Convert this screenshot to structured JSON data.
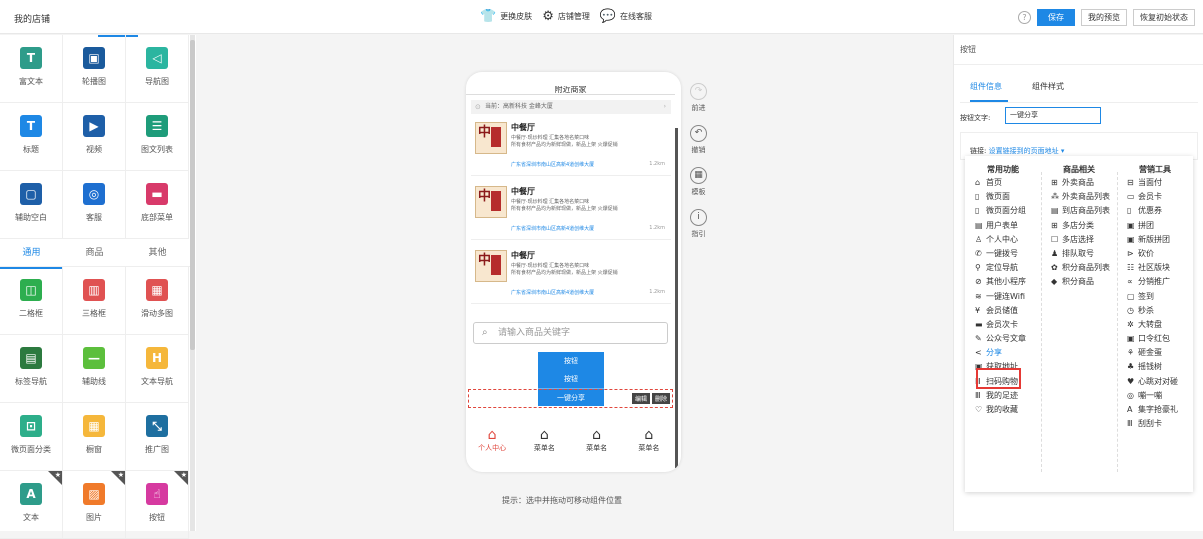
{
  "topbar": {
    "shop_title": "我的店铺",
    "actions": [
      {
        "label": "更换皮肤",
        "icon": "shirt-icon"
      },
      {
        "label": "店铺管理",
        "icon": "gear-icon"
      },
      {
        "label": "在线客服",
        "icon": "chat-icon"
      }
    ],
    "help": "?",
    "save_label": "保存",
    "preview_label": "我的预览",
    "reset_label": "恢复初始状态"
  },
  "components": {
    "basic": [
      {
        "label": "富文本",
        "color": "#2e9c8a",
        "glyph": "T"
      },
      {
        "label": "轮播图",
        "color": "#1a5a9c",
        "glyph": "▣"
      },
      {
        "label": "导航图",
        "color": "#2bb5a0",
        "glyph": "◁"
      },
      {
        "label": "标题",
        "color": "#1e88e5",
        "glyph": "T"
      },
      {
        "label": "视频",
        "color": "#1e5fa8",
        "glyph": "▶"
      },
      {
        "label": "图文列表",
        "color": "#1e9c7a",
        "glyph": "☰"
      },
      {
        "label": "辅助空白",
        "color": "#1e5fa8",
        "glyph": "▢"
      },
      {
        "label": "客服",
        "color": "#1e6fd0",
        "glyph": "◎"
      },
      {
        "label": "底部菜单",
        "color": "#d83a6a",
        "glyph": "▬"
      }
    ],
    "tabs": [
      "通用",
      "商品",
      "其他"
    ],
    "active_tab": "通用",
    "general": [
      {
        "label": "二格框",
        "color": "#2dae4f",
        "glyph": "◫"
      },
      {
        "label": "三格框",
        "color": "#e05252",
        "glyph": "▥"
      },
      {
        "label": "滑动多图",
        "color": "#e05252",
        "glyph": "▦"
      },
      {
        "label": "标签导航",
        "color": "#2c7a3f",
        "glyph": "▤"
      },
      {
        "label": "辅助线",
        "color": "#5cbf3c",
        "glyph": "—"
      },
      {
        "label": "文本导航",
        "color": "#f5b73b",
        "glyph": "H"
      },
      {
        "label": "微页面分类",
        "color": "#2dae8a",
        "glyph": "⊡"
      },
      {
        "label": "橱窗",
        "color": "#f5b73b",
        "glyph": "▦"
      },
      {
        "label": "推广图",
        "color": "#1e6fa0",
        "glyph": "⤡"
      },
      {
        "label": "文本",
        "color": "#2e9c8a",
        "glyph": "A",
        "starred": true
      },
      {
        "label": "图片",
        "color": "#f07a2a",
        "glyph": "▨",
        "starred": true
      },
      {
        "label": "按钮",
        "color": "#d63aa0",
        "glyph": "☝",
        "starred": true
      }
    ]
  },
  "phone": {
    "title": "附近商家",
    "location": "当前：高新科技 金峰大厦",
    "stores": [
      {
        "name": "中餐厅",
        "d1": "中餐厅·现炒料理  汇集各地名菜口味",
        "d2": "所有食材产品均为新鲜现做，新品上架  火爆促销",
        "addr": "广东省深圳市南山区高新4道创维大厦",
        "dist": "1.2km"
      },
      {
        "name": "中餐厅",
        "d1": "中餐厅·现炒料理  汇集各地名菜口味",
        "d2": "所有食材产品均为新鲜现做，新品上架  火爆促销",
        "addr": "广东省深圳市南山区高新4道创维大厦",
        "dist": "1.2km"
      },
      {
        "name": "中餐厅",
        "d1": "中餐厅·现炒料理  汇集各地名菜口味",
        "d2": "所有食材产品均为新鲜现做，新品上架  火爆促销",
        "addr": "广东省深圳市南山区高新4道创维大厦",
        "dist": "1.2km"
      }
    ],
    "thumb_text": "中",
    "search_placeholder": "请输入商品关键字",
    "buttons": [
      "按钮",
      "按钮",
      "一键分享"
    ],
    "edit_label": "编辑",
    "delete_label": "删除",
    "tabbar": [
      {
        "label": "个人中心",
        "active": true
      },
      {
        "label": "菜单名",
        "active": false
      },
      {
        "label": "菜单名",
        "active": false
      },
      {
        "label": "菜单名",
        "active": false
      }
    ]
  },
  "hint": "提示：选中并拖动可移动组件位置",
  "side_actions": [
    {
      "label": "前进",
      "glyph": "↷",
      "dim": true
    },
    {
      "label": "撤销",
      "glyph": "↶",
      "dim": false
    },
    {
      "label": "模板",
      "glyph": "▦",
      "dim": false
    },
    {
      "label": "指引",
      "glyph": "i",
      "dim": false
    }
  ],
  "right": {
    "title": "按钮",
    "tabs": [
      "组件信息",
      "组件样式"
    ],
    "text_label": "按钮文字:",
    "text_value": "一键分享",
    "link_label": "链接:",
    "link_value": "设置链接到的页面地址 ▾",
    "menu": {
      "columns": [
        {
          "header": "常用功能",
          "items": [
            {
              "g": "⌂",
              "t": "首页"
            },
            {
              "g": "▯",
              "t": "微页面"
            },
            {
              "g": "▯",
              "t": "微页面分组"
            },
            {
              "g": "▤",
              "t": "用户表单"
            },
            {
              "g": "♙",
              "t": "个人中心"
            },
            {
              "g": "✆",
              "t": "一键拨号"
            },
            {
              "g": "⚲",
              "t": "定位导航"
            },
            {
              "g": "⊘",
              "t": "其他小程序"
            },
            {
              "g": "≋",
              "t": "一键连Wifi"
            },
            {
              "g": "¥",
              "t": "会员储值"
            },
            {
              "g": "▬",
              "t": "会员次卡"
            },
            {
              "g": "✎",
              "t": "公众号文章"
            },
            {
              "g": "<",
              "t": "分享",
              "share": true
            },
            {
              "g": "▣",
              "t": "获取地址"
            },
            {
              "g": "Ⅲ",
              "t": "扫码购物"
            },
            {
              "g": "Ⅲ",
              "t": "我的足迹"
            },
            {
              "g": "♡",
              "t": "我的收藏"
            }
          ]
        },
        {
          "header": "商品相关",
          "items": [
            {
              "g": "⊞",
              "t": "外卖商品"
            },
            {
              "g": "⁂",
              "t": "外卖商品列表"
            },
            {
              "g": "▤",
              "t": "到店商品列表"
            },
            {
              "g": "⊞",
              "t": "多店分类"
            },
            {
              "g": "☐",
              "t": "多店选择"
            },
            {
              "g": "♟",
              "t": "排队取号"
            },
            {
              "g": "✿",
              "t": "积分商品列表"
            },
            {
              "g": "◆",
              "t": "积分商品"
            }
          ]
        },
        {
          "header": "营销工具",
          "items": [
            {
              "g": "⊟",
              "t": "当面付"
            },
            {
              "g": "▭",
              "t": "会员卡"
            },
            {
              "g": "▯",
              "t": "优惠券"
            },
            {
              "g": "▣",
              "t": "拼团"
            },
            {
              "g": "▣",
              "t": "新版拼团"
            },
            {
              "g": "⊳",
              "t": "砍价"
            },
            {
              "g": "☷",
              "t": "社区版块"
            },
            {
              "g": "∝",
              "t": "分销推广"
            },
            {
              "g": "▢",
              "t": "签到"
            },
            {
              "g": "◷",
              "t": "秒杀"
            },
            {
              "g": "✲",
              "t": "大转盘"
            },
            {
              "g": "▣",
              "t": "口令红包"
            },
            {
              "g": "⚘",
              "t": "砸金蛋"
            },
            {
              "g": "♣",
              "t": "摇钱树"
            },
            {
              "g": "♥",
              "t": "心跳对对碰"
            },
            {
              "g": "◎",
              "t": "嘣一嘣"
            },
            {
              "g": "A",
              "t": "集字抢豪礼"
            },
            {
              "g": "Ⅲ",
              "t": "刮刮卡"
            }
          ]
        }
      ]
    }
  }
}
